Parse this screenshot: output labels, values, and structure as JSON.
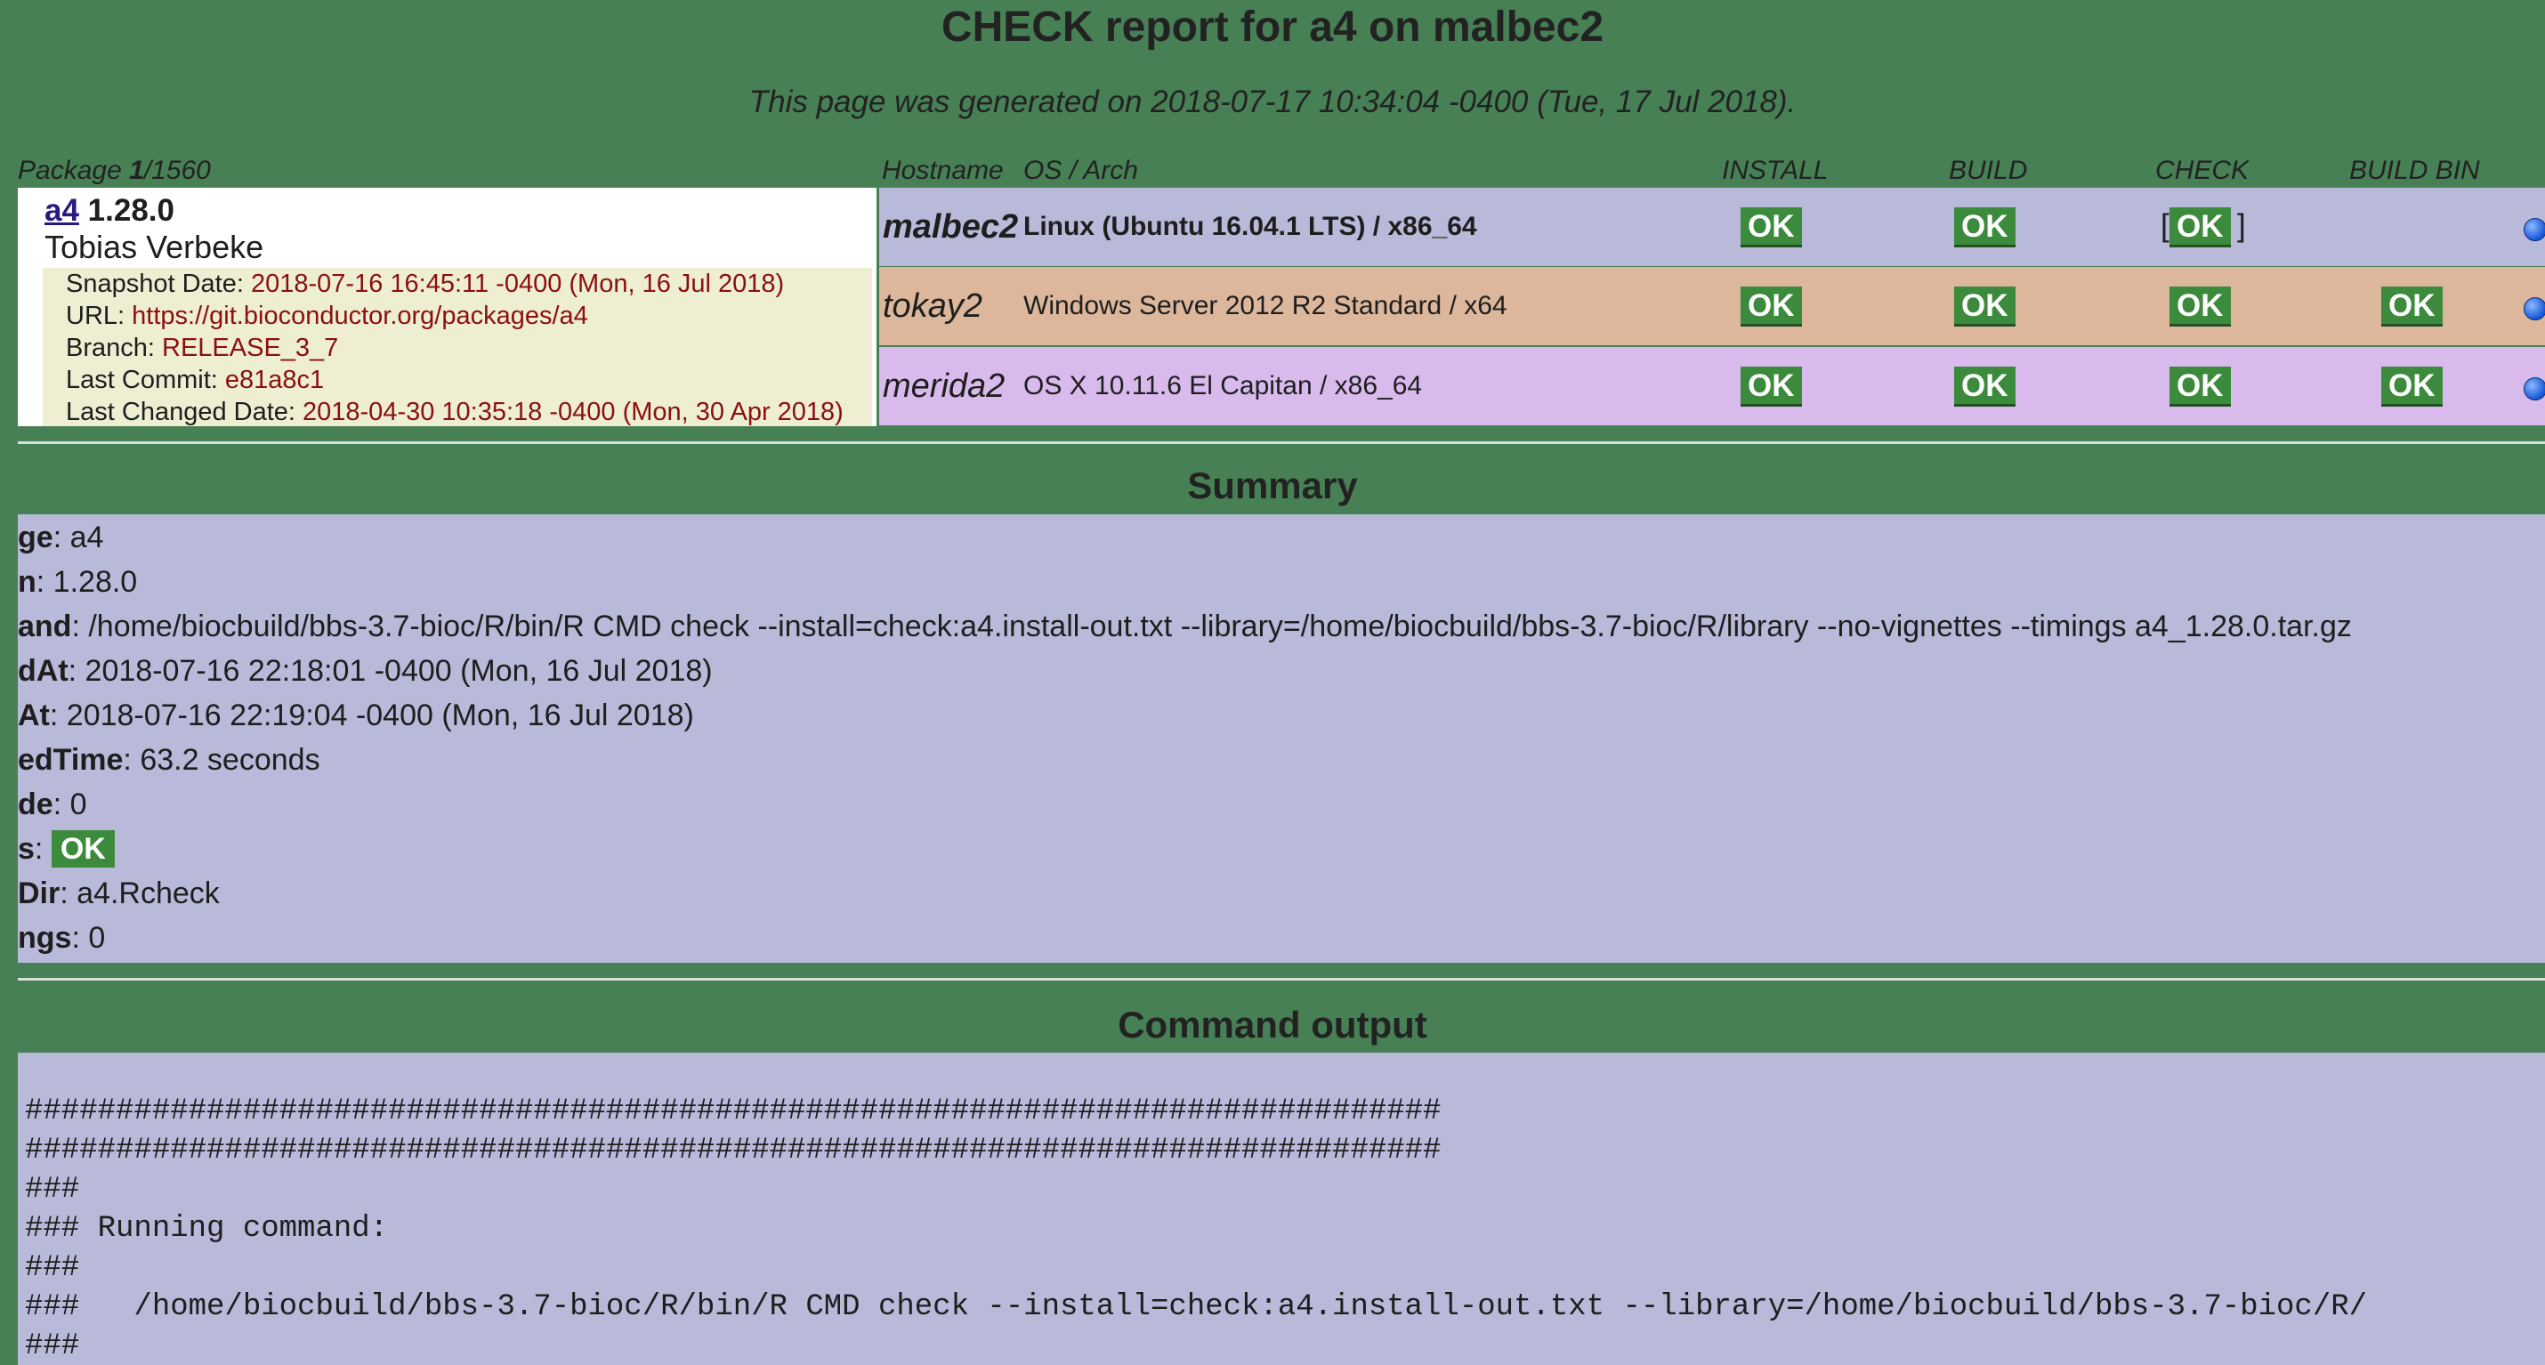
{
  "header": {
    "title": "CHECK report for a4 on malbec2",
    "generated": "This page was generated on 2018-07-17 10:34:04 -0400 (Tue, 17 Jul 2018)."
  },
  "columns": {
    "package_prefix": "Package ",
    "package_num": "1",
    "package_total": "/1560",
    "hostname": "Hostname",
    "os_arch": "OS / Arch",
    "install": "INSTALL",
    "build": "BUILD",
    "check": "CHECK",
    "build_bin": "BUILD BIN"
  },
  "package": {
    "name": "a4",
    "version": "1.28.0",
    "maintainer": "Tobias Verbeke",
    "info": [
      {
        "label": "Snapshot Date: ",
        "value": "2018-07-16 16:45:11 -0400 (Mon, 16 Jul 2018)"
      },
      {
        "label": "URL: ",
        "value": "https://git.bioconductor.org/packages/a4"
      },
      {
        "label": "Branch: ",
        "value": "RELEASE_3_7"
      },
      {
        "label": "Last Commit: ",
        "value": "e81a8c1"
      },
      {
        "label": "Last Changed Date: ",
        "value": "2018-04-30 10:35:18 -0400 (Mon, 30 Apr 2018)"
      }
    ]
  },
  "hosts": [
    {
      "name": "malbec2",
      "os": "Linux (Ubuntu 16.04.1 LTS) / x86_64",
      "install": "OK",
      "build": "OK",
      "check": "OK",
      "build_bin": "",
      "color": "#b9b9da"
    },
    {
      "name": "tokay2",
      "os": "Windows Server 2012 R2 Standard / x64",
      "install": "OK",
      "build": "OK",
      "check": "OK",
      "build_bin": "OK",
      "color": "#dcb79c"
    },
    {
      "name": "merida2",
      "os": "OS X 10.11.6 El Capitan / x86_64",
      "install": "OK",
      "build": "OK",
      "check": "OK",
      "build_bin": "OK",
      "color": "#d9baec"
    }
  ],
  "bracket_open": "[",
  "bracket_close": "]",
  "summary": {
    "title": "Summary",
    "rows": [
      {
        "key": "ge",
        "value": ": a4"
      },
      {
        "key": "n",
        "value": ": 1.28.0"
      },
      {
        "key": "and",
        "value": ": /home/biocbuild/bbs-3.7-bioc/R/bin/R CMD check --install=check:a4.install-out.txt --library=/home/biocbuild/bbs-3.7-bioc/R/library --no-vignettes --timings a4_1.28.0.tar.gz"
      },
      {
        "key": "dAt",
        "value": ": 2018-07-16 22:18:01 -0400 (Mon, 16 Jul 2018)"
      },
      {
        "key": "At",
        "value": ": 2018-07-16 22:19:04 -0400 (Mon, 16 Jul 2018)"
      },
      {
        "key": "edTime",
        "value": ": 63.2 seconds"
      },
      {
        "key": "de",
        "value": ": 0"
      },
      {
        "key": "s",
        "value": ": "
      },
      {
        "key": "Dir",
        "value": ": a4.Rcheck"
      },
      {
        "key": "ngs",
        "value": ": 0"
      }
    ],
    "status_ok": "OK"
  },
  "command_output": {
    "title": "Command output",
    "lines": [
      "##############################################################################",
      "##############################################################################",
      "###",
      "### Running command:",
      "###",
      "###   /home/biocbuild/bbs-3.7-bioc/R/bin/R CMD check --install=check:a4.install-out.txt --library=/home/biocbuild/bbs-3.7-bioc/R/",
      "###"
    ]
  }
}
